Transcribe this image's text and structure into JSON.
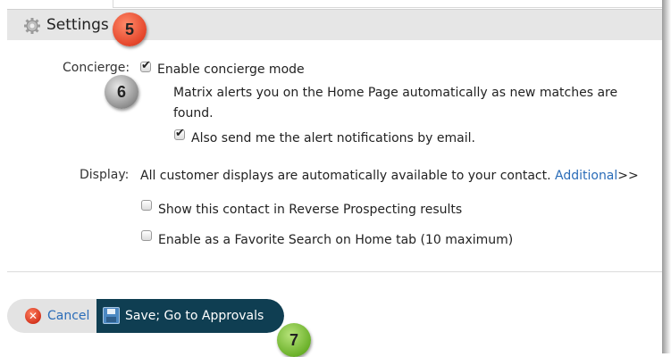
{
  "settings": {
    "title": "Settings"
  },
  "callouts": {
    "c5": "5",
    "c6": "6",
    "c7": "7"
  },
  "concierge": {
    "label": "Concierge:",
    "enable_label": "Enable concierge mode",
    "enable_checked": true,
    "description_line1": "Matrix alerts you on the Home Page automatically as new matches are",
    "description_line2": "found.",
    "email_label": "Also send me the alert notifications by email.",
    "email_checked": true
  },
  "display": {
    "label": "Display:",
    "text": "All customer displays are automatically available to your contact.",
    "link": "Additional",
    "suffix": ">>",
    "reverse_label": "Show this contact in Reverse Prospecting results",
    "reverse_checked": false,
    "favorite_label": "Enable as a Favorite Search on Home tab (10 maximum)",
    "favorite_checked": false
  },
  "actions": {
    "cancel_label": "Cancel",
    "save_label": "Save; Go to Approvals"
  },
  "colors": {
    "accent_link": "#2a6cb8",
    "save_button_bg": "#0f3e52",
    "callout_5": "#e4452a",
    "callout_6": "#8d8d8d",
    "callout_7": "#6bb12a"
  },
  "icons": {
    "settings": "gear-icon",
    "cancel": "cancel-x-icon",
    "save": "floppy-disk-icon",
    "check": "checkmark-icon"
  }
}
